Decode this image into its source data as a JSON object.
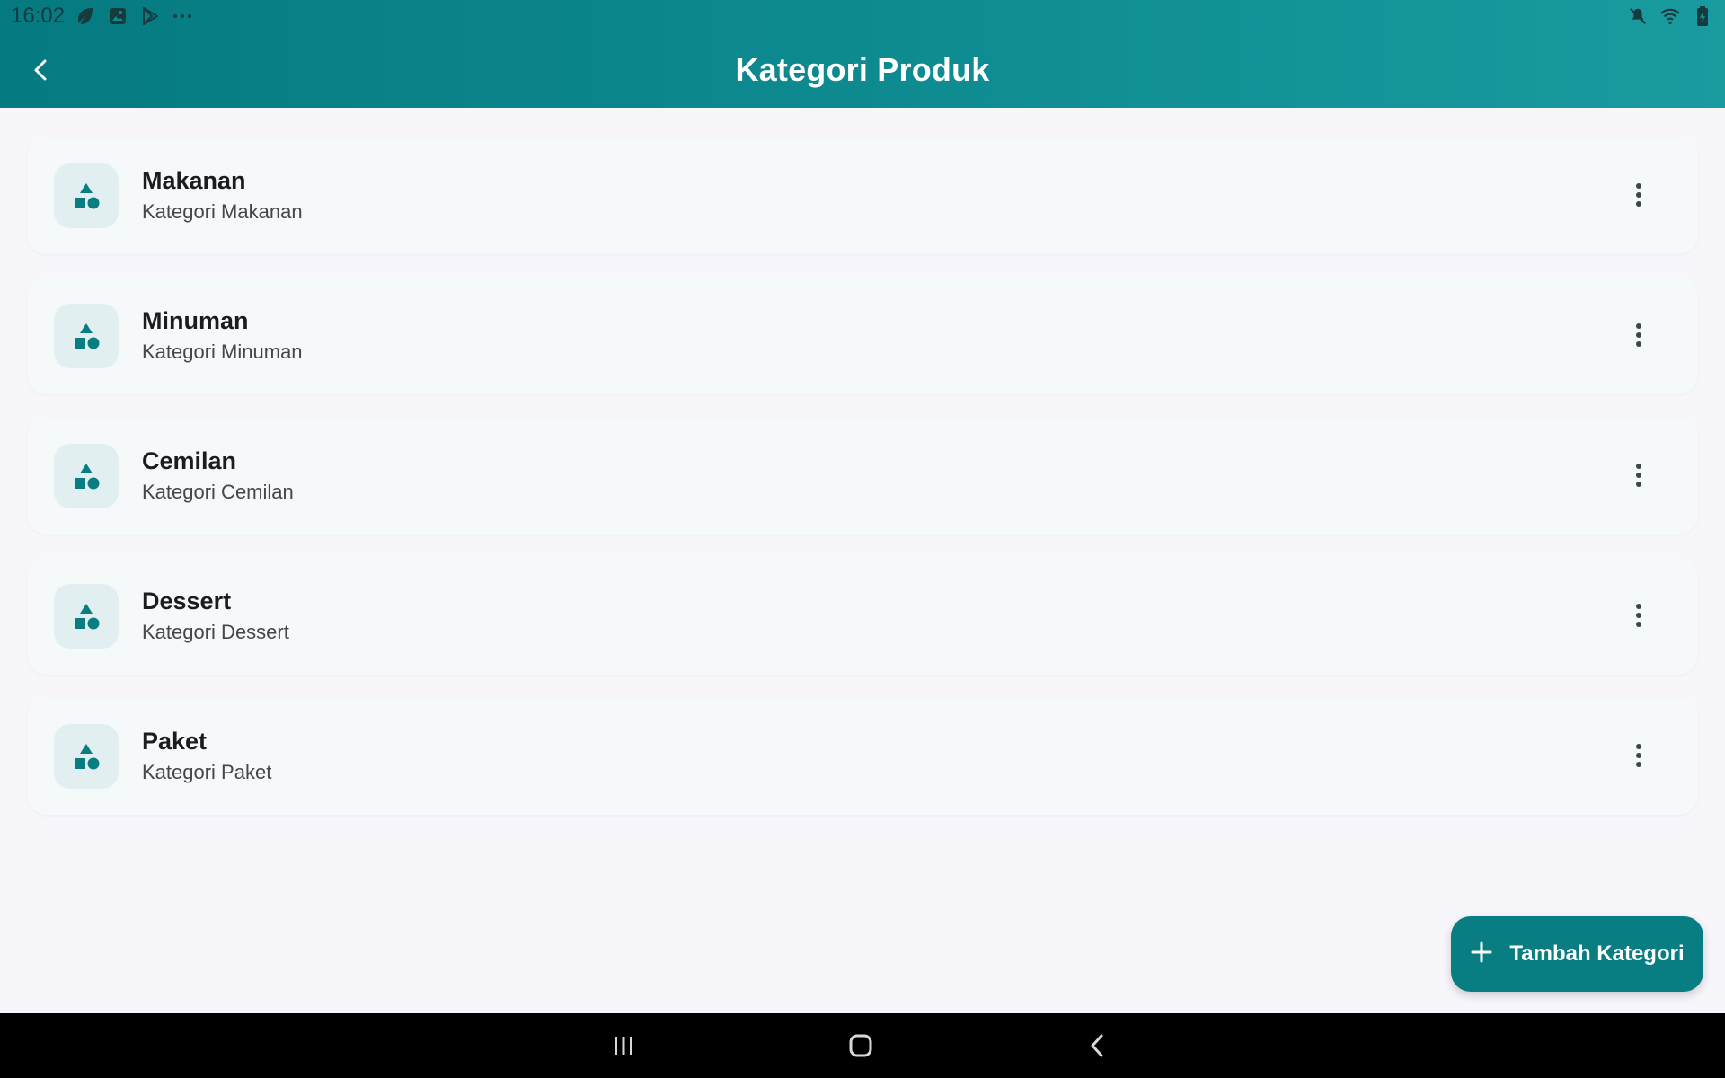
{
  "status_bar": {
    "time": "16:02",
    "left_icons": [
      "leaf-icon",
      "gallery-icon",
      "play-store-icon",
      "more-dots-icon"
    ],
    "right_icons": [
      "mute-icon",
      "wifi-icon",
      "battery-icon"
    ]
  },
  "header": {
    "title": "Kategori Produk",
    "back_icon": "back-arrow-icon"
  },
  "categories": [
    {
      "name": "Makanan",
      "description": "Kategori Makanan",
      "icon": "category-shapes-icon"
    },
    {
      "name": "Minuman",
      "description": "Kategori Minuman",
      "icon": "category-shapes-icon"
    },
    {
      "name": "Cemilan",
      "description": "Kategori Cemilan",
      "icon": "category-shapes-icon"
    },
    {
      "name": "Dessert",
      "description": "Kategori Dessert",
      "icon": "category-shapes-icon"
    },
    {
      "name": "Paket",
      "description": "Kategori Paket",
      "icon": "category-shapes-icon"
    }
  ],
  "fab": {
    "label": "Tambah Kategori",
    "icon": "plus-icon"
  },
  "nav_bar": {
    "buttons": [
      "recents-icon",
      "home-icon",
      "back-icon"
    ]
  },
  "colors": {
    "primary": "#087d82",
    "header_gradient_start": "#057a80",
    "header_gradient_end": "#1a9ba0",
    "card_bg": "#f6f9fa",
    "icon_bg": "#e1eff0",
    "page_bg": "#f7f6fb"
  }
}
